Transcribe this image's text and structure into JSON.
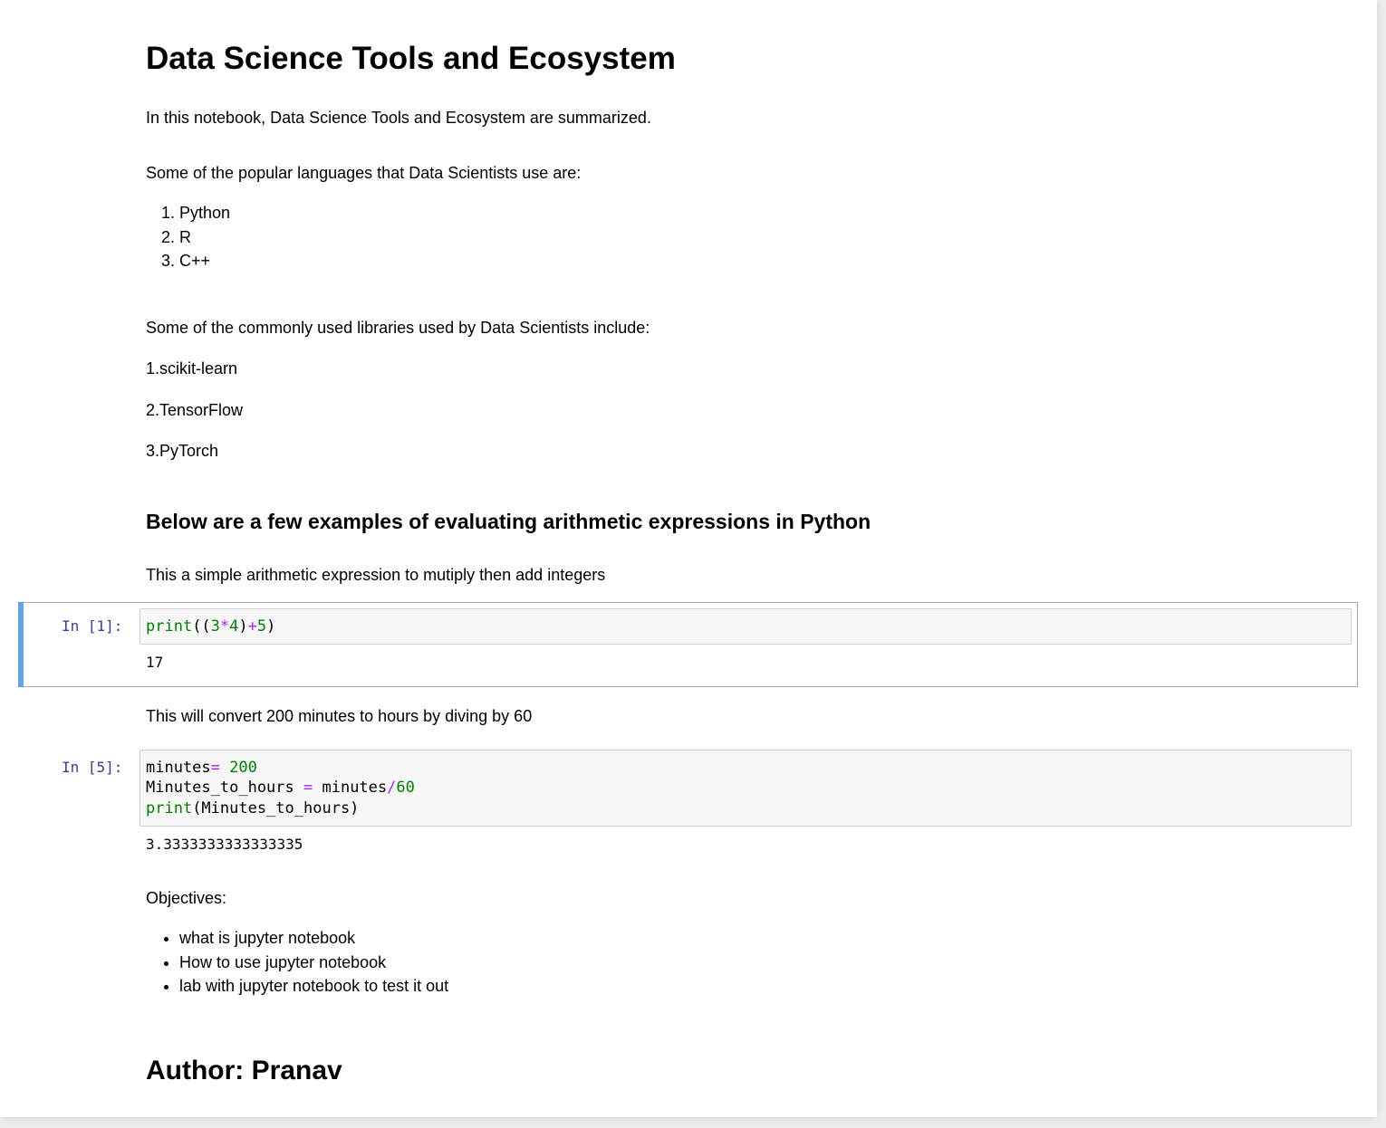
{
  "title": "Data Science Tools and Ecosystem",
  "intro": "In this notebook, Data Science Tools and Ecosystem are summarized.",
  "languages": {
    "heading": "Some of the popular languages that Data Scientists use are:",
    "items": [
      "Python",
      "R",
      "C++"
    ]
  },
  "libraries": {
    "heading": "Some of the commonly used libraries used by Data Scientists include:",
    "items": [
      "1.scikit-learn",
      "2.TensorFlow",
      "3.PyTorch"
    ]
  },
  "arithmetic": {
    "heading": "Below are a few examples of evaluating arithmetic expressions in Python",
    "description": "This a simple arithmetic expression to mutiply then add integers"
  },
  "cells": [
    {
      "prompt": "In [1]:",
      "code_lines": [
        [
          {
            "t": "print",
            "c": "builtin"
          },
          {
            "t": "((",
            "c": ""
          },
          {
            "t": "3",
            "c": "num"
          },
          {
            "t": "*",
            "c": "op"
          },
          {
            "t": "4",
            "c": "num"
          },
          {
            "t": ")",
            "c": ""
          },
          {
            "t": "+",
            "c": "op"
          },
          {
            "t": "5",
            "c": "num"
          },
          {
            "t": ")",
            "c": ""
          }
        ]
      ],
      "output": "17"
    },
    {
      "prompt": "In [5]:",
      "code_lines": [
        [
          {
            "t": "minutes",
            "c": ""
          },
          {
            "t": "=",
            "c": "op"
          },
          {
            "t": " ",
            "c": ""
          },
          {
            "t": "200",
            "c": "num"
          }
        ],
        [
          {
            "t": "Minutes_to_hours ",
            "c": ""
          },
          {
            "t": "=",
            "c": "op"
          },
          {
            "t": " minutes",
            "c": ""
          },
          {
            "t": "/",
            "c": "op"
          },
          {
            "t": "60",
            "c": "num"
          }
        ],
        [
          {
            "t": "print",
            "c": "builtin"
          },
          {
            "t": "(Minutes_to_hours)",
            "c": ""
          }
        ]
      ],
      "output": "3.3333333333333335"
    }
  ],
  "conversion_description": "This will convert 200 minutes to hours by diving by 60",
  "objectives": {
    "heading": "Objectives:",
    "items": [
      "what is jupyter notebook",
      "How to use jupyter notebook",
      "lab with jupyter notebook to test it out"
    ]
  },
  "author": "Author: Pranav",
  "colors": {
    "prompt": "#303f9f",
    "selected_bar": "#66a3e6",
    "builtin": "#008000",
    "operator": "#aa22ff",
    "code_bg": "#f7f7f7"
  }
}
